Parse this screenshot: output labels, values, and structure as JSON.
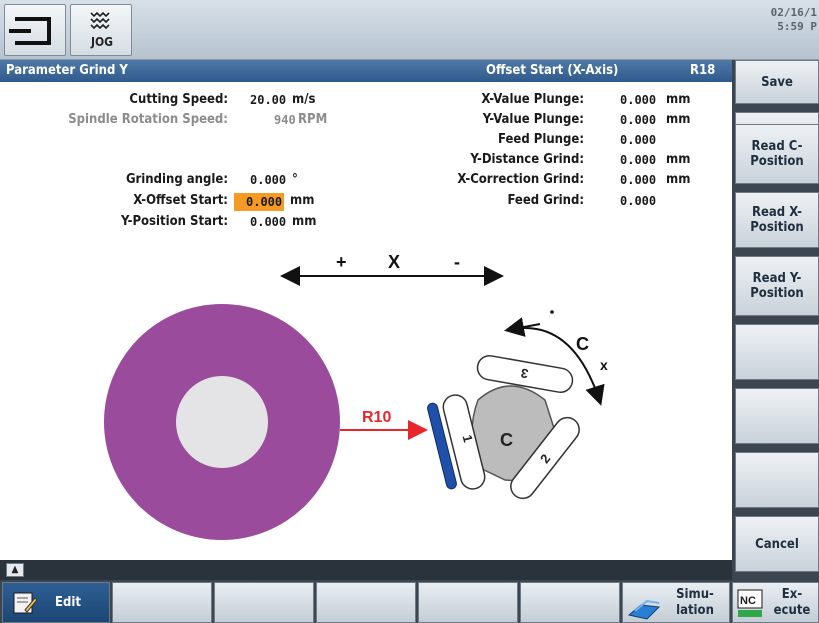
{
  "topbar": {
    "mode_label": "JOG",
    "date": "02/16/1",
    "time": "5:59 P"
  },
  "header": {
    "title": "Parameter Grind Y",
    "status": "Offset Start (X-Axis)",
    "code": "R18"
  },
  "fields_left": [
    {
      "label": "Cutting Speed:",
      "value": "20.00",
      "unit": "m/s",
      "dim": false
    },
    {
      "label": "Spindle Rotation Speed:",
      "value": "940",
      "unit": "RPM",
      "dim": true
    },
    {
      "label": "Grinding angle:",
      "value": "0.000",
      "unit": "°",
      "dim": false
    },
    {
      "label": "X-Offset Start:",
      "value": "0.000",
      "unit": "mm",
      "dim": false,
      "active": true
    },
    {
      "label": "Y-Position Start:",
      "value": "0.000",
      "unit": "mm",
      "dim": false
    }
  ],
  "fields_right": [
    {
      "label": "X-Value Plunge:",
      "value": "0.000",
      "unit": "mm"
    },
    {
      "label": "Y-Value Plunge:",
      "value": "0.000",
      "unit": "mm"
    },
    {
      "label": "Feed Plunge:",
      "value": "0.000",
      "unit": ""
    },
    {
      "label": "Y-Distance Grind:",
      "value": "0.000",
      "unit": "mm"
    },
    {
      "label": "X-Correction Grind:",
      "value": "0.000",
      "unit": "mm"
    },
    {
      "label": "Feed Grind:",
      "value": "0.000",
      "unit": ""
    }
  ],
  "diagram": {
    "x_axis_plus": "+",
    "x_axis_label": "X",
    "x_axis_minus": "-",
    "radius_label": "R10",
    "c_label": "C",
    "c_axis_label": "C",
    "c_tick_label": "x",
    "stone_labels": [
      "1",
      "2",
      "3"
    ],
    "colors": {
      "wheel": "#9b4b9b",
      "stone": "#1f4fa8",
      "arrow": "#e8262a"
    }
  },
  "softkeys_vertical": [
    "Save",
    "",
    "Read C-Position",
    "Read X-Position",
    "Read Y-Position",
    "",
    "",
    "",
    "Cancel"
  ],
  "softkeys_horizontal": [
    "Edit",
    "",
    "",
    "",
    "",
    "",
    "Simu-lation",
    "Ex-ecute"
  ],
  "icons": [
    "machine-icon",
    "jog-icon",
    "edit-icon",
    "simulation-icon",
    "nc-execute-icon",
    "scroll-up-icon"
  ]
}
